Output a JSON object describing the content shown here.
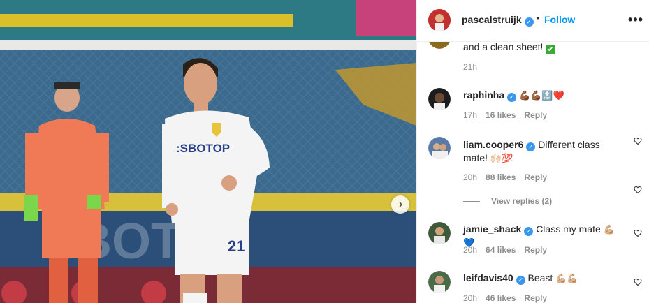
{
  "post": {
    "author": "pascalstruijk",
    "follow_label": "Follow",
    "separator": "•",
    "more_label": "•••",
    "next_label": "›"
  },
  "comments": [
    {
      "user": "",
      "text": "and a clean sheet!",
      "emoji": "✔",
      "time": "21h",
      "likes": "",
      "reply": ""
    },
    {
      "user": "raphinha",
      "text": "",
      "emoji": "💪🏾💪🏾🔝❤️",
      "time": "17h",
      "likes": "16 likes",
      "reply": "Reply"
    },
    {
      "user": "liam.cooper6",
      "text": "Different class mate!",
      "emoji": "🙌🏻💯",
      "time": "20h",
      "likes": "88 likes",
      "reply": "Reply"
    },
    {
      "user": "jamie_shack",
      "text": "Class my mate",
      "emoji": "💪🏼💙",
      "time": "20h",
      "likes": "64 likes",
      "reply": "Reply"
    },
    {
      "user": "leifdavis40",
      "text": "Beast",
      "emoji": "💪🏼💪🏼",
      "time": "20h",
      "likes": "46 likes",
      "reply": "Reply"
    }
  ],
  "view_replies": "View replies (2)",
  "icons": {
    "verified": "verified-badge",
    "heart": "heart-outline",
    "more": "more-horizontal",
    "next": "chevron-right"
  },
  "colors": {
    "link": "#0095f6",
    "verified": "#3897f0",
    "text": "#262626",
    "secondary": "#8e8e8e"
  }
}
